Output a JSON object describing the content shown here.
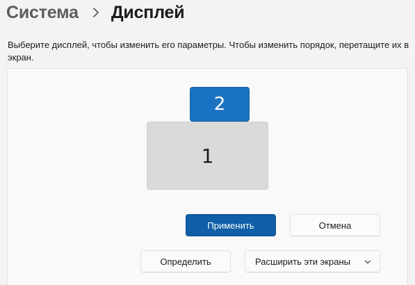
{
  "header": {
    "breadcrumb_parent": "Система",
    "breadcrumb_current": "Дисплей"
  },
  "main": {
    "description": "Выберите дисплей, чтобы изменить его параметры. Чтобы изменить порядок, перетащите их в экран.",
    "monitors": [
      {
        "label": "1",
        "selected": false
      },
      {
        "label": "2",
        "selected": true
      }
    ],
    "apply_label": "Применить",
    "cancel_label": "Отмена",
    "identify_label": "Определить",
    "multi_display": {
      "selected": "Расширить эти экраны"
    }
  },
  "colors": {
    "accent": "#0f5ea8",
    "selected_monitor": "#1a72c2",
    "monitor": "#dadada",
    "background": "#f3f3f3"
  },
  "icons": {
    "breadcrumb_separator": "chevron-right-icon",
    "dropdown": "chevron-down-icon"
  }
}
